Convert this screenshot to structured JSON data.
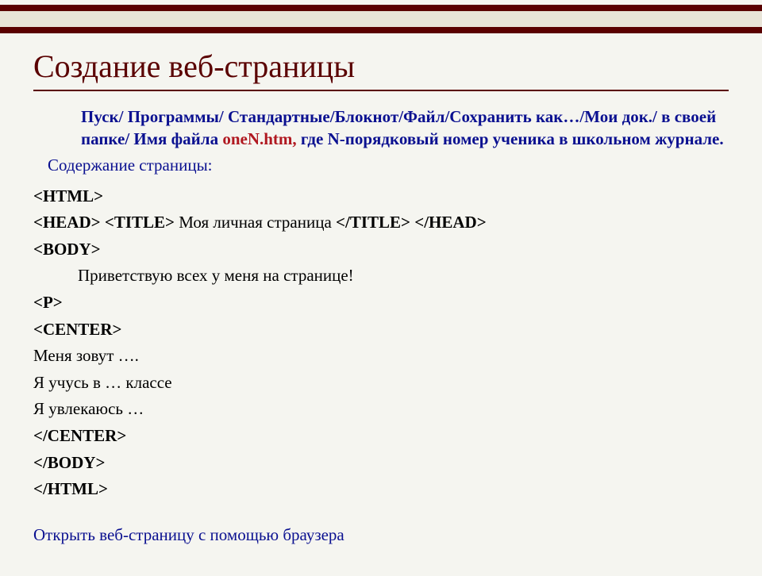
{
  "title": "Создание веб-страницы",
  "intro": {
    "line1_prefix": "Пуск/ Программы/ Стандартные/Блокнот/Файл/Сохранить как…/Мои док./ в своей папке/  Имя файла ",
    "filename": "oneN.htm,",
    "line1_suffix": " где  N-порядковый номер ученика  в школьном журнале."
  },
  "subhead": "Содержание страницы:",
  "code": {
    "html_open": "<HTML>",
    "head_open": "<HEAD>",
    "title_open": "<TITLE>",
    "title_text": " Моя личная страница ",
    "title_close": "</TITLE>",
    "head_close": "</HEAD>",
    "body_open": "<BODY>",
    "greeting": "Приветствую всех у меня на странице!",
    "p_tag": "<P>",
    "center_open": "<CENTER>",
    "line_name": " Меня зовут ….",
    "line_study": "Я учусь в  … классе",
    "line_hobby": "Я увлекаюсь …",
    "center_close": "</CENTER>",
    "body_close": "</BODY>",
    "html_close": "</HTML>"
  },
  "footer": "Открыть веб-страницу с помощью браузера"
}
